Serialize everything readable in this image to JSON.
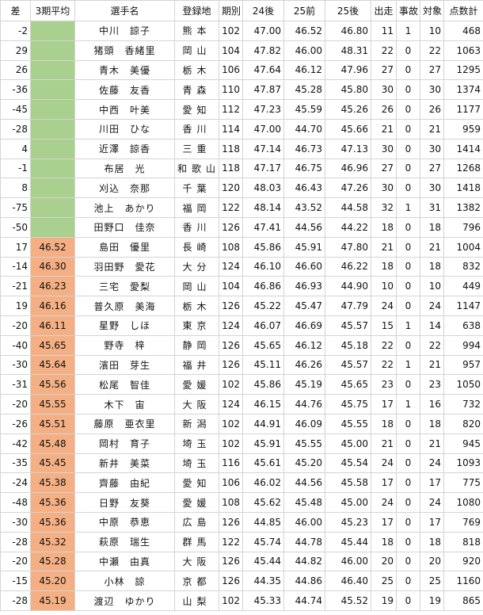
{
  "colors": {
    "green": "#a9d08e",
    "orange": "#f4b084",
    "grid": "#d4d4d4"
  },
  "headers": [
    "差",
    "3期平均",
    "選手名",
    "登録地",
    "期別",
    "24後",
    "25前",
    "25後",
    "出走",
    "事故",
    "対象",
    "点数計"
  ],
  "rows": [
    {
      "diff": "-2",
      "avg": "",
      "name": "中川　諒子",
      "region": "熊本",
      "ki": "102",
      "s24b": "47.00",
      "s25f": "46.52",
      "s25b": "46.80",
      "starts": "11",
      "acc": "1",
      "tgt": "10",
      "pts": "468",
      "band": "green"
    },
    {
      "diff": "29",
      "avg": "",
      "name": "猪頭　香緒里",
      "region": "岡山",
      "ki": "104",
      "s24b": "47.82",
      "s25f": "46.00",
      "s25b": "48.31",
      "starts": "22",
      "acc": "0",
      "tgt": "22",
      "pts": "1063",
      "band": "green"
    },
    {
      "diff": "26",
      "avg": "",
      "name": "青木　美優",
      "region": "栃木",
      "ki": "106",
      "s24b": "47.64",
      "s25f": "46.12",
      "s25b": "47.96",
      "starts": "27",
      "acc": "0",
      "tgt": "27",
      "pts": "1295",
      "band": "green"
    },
    {
      "diff": "-36",
      "avg": "",
      "name": "佐藤　友香",
      "region": "青森",
      "ki": "110",
      "s24b": "47.87",
      "s25f": "45.28",
      "s25b": "45.80",
      "starts": "30",
      "acc": "0",
      "tgt": "30",
      "pts": "1374",
      "band": "green"
    },
    {
      "diff": "-45",
      "avg": "",
      "name": "中西　叶美",
      "region": "愛知",
      "ki": "112",
      "s24b": "47.23",
      "s25f": "45.59",
      "s25b": "45.26",
      "starts": "26",
      "acc": "0",
      "tgt": "26",
      "pts": "1177",
      "band": "green"
    },
    {
      "diff": "-28",
      "avg": "",
      "name": "川田　ひな",
      "region": "香川",
      "ki": "114",
      "s24b": "47.00",
      "s25f": "44.70",
      "s25b": "45.66",
      "starts": "21",
      "acc": "0",
      "tgt": "21",
      "pts": "959",
      "band": "green"
    },
    {
      "diff": "4",
      "avg": "",
      "name": "近澤　諒香",
      "region": "三重",
      "ki": "118",
      "s24b": "47.14",
      "s25f": "46.73",
      "s25b": "47.13",
      "starts": "30",
      "acc": "0",
      "tgt": "30",
      "pts": "1414",
      "band": "green"
    },
    {
      "diff": "-1",
      "avg": "",
      "name": "布居　光",
      "region": "和歌山",
      "ki": "118",
      "s24b": "47.17",
      "s25f": "46.75",
      "s25b": "46.96",
      "starts": "27",
      "acc": "0",
      "tgt": "27",
      "pts": "1268",
      "band": "green"
    },
    {
      "diff": "8",
      "avg": "",
      "name": "刈込　奈那",
      "region": "千葉",
      "ki": "120",
      "s24b": "48.03",
      "s25f": "46.43",
      "s25b": "47.26",
      "starts": "30",
      "acc": "0",
      "tgt": "30",
      "pts": "1418",
      "band": "green"
    },
    {
      "diff": "-75",
      "avg": "",
      "name": "池上　あかり",
      "region": "福岡",
      "ki": "122",
      "s24b": "48.14",
      "s25f": "43.52",
      "s25b": "44.58",
      "starts": "32",
      "acc": "1",
      "tgt": "31",
      "pts": "1382",
      "band": "green"
    },
    {
      "diff": "-50",
      "avg": "",
      "name": "田野口　佳奈",
      "region": "香川",
      "ki": "126",
      "s24b": "47.41",
      "s25f": "44.56",
      "s25b": "44.22",
      "starts": "18",
      "acc": "0",
      "tgt": "18",
      "pts": "796",
      "band": "green"
    },
    {
      "diff": "17",
      "avg": "46.52",
      "name": "島田　優里",
      "region": "長崎",
      "ki": "108",
      "s24b": "45.86",
      "s25f": "45.91",
      "s25b": "47.80",
      "starts": "21",
      "acc": "0",
      "tgt": "21",
      "pts": "1004",
      "band": "orange"
    },
    {
      "diff": "-14",
      "avg": "46.30",
      "name": "羽田野　愛花",
      "region": "大分",
      "ki": "124",
      "s24b": "46.10",
      "s25f": "46.60",
      "s25b": "46.22",
      "starts": "18",
      "acc": "0",
      "tgt": "18",
      "pts": "832",
      "band": "orange"
    },
    {
      "diff": "-21",
      "avg": "46.23",
      "name": "三宅　愛梨",
      "region": "岡山",
      "ki": "104",
      "s24b": "46.86",
      "s25f": "46.93",
      "s25b": "44.90",
      "starts": "10",
      "acc": "0",
      "tgt": "10",
      "pts": "449",
      "band": "orange"
    },
    {
      "diff": "19",
      "avg": "46.16",
      "name": "普久原　美海",
      "region": "栃木",
      "ki": "126",
      "s24b": "45.22",
      "s25f": "45.47",
      "s25b": "47.79",
      "starts": "24",
      "acc": "0",
      "tgt": "24",
      "pts": "1147",
      "band": "orange"
    },
    {
      "diff": "-20",
      "avg": "46.11",
      "name": "星野　しほ",
      "region": "東京",
      "ki": "124",
      "s24b": "46.07",
      "s25f": "46.69",
      "s25b": "45.57",
      "starts": "15",
      "acc": "1",
      "tgt": "14",
      "pts": "638",
      "band": "orange"
    },
    {
      "diff": "-40",
      "avg": "45.65",
      "name": "野寺　梓",
      "region": "静岡",
      "ki": "126",
      "s24b": "45.65",
      "s25f": "46.12",
      "s25b": "45.18",
      "starts": "22",
      "acc": "0",
      "tgt": "22",
      "pts": "994",
      "band": "orange"
    },
    {
      "diff": "-30",
      "avg": "45.64",
      "name": "濱田　芽生",
      "region": "福井",
      "ki": "126",
      "s24b": "45.11",
      "s25f": "46.26",
      "s25b": "45.57",
      "starts": "22",
      "acc": "1",
      "tgt": "21",
      "pts": "957",
      "band": "orange"
    },
    {
      "diff": "-31",
      "avg": "45.56",
      "name": "松尾　智佳",
      "region": "愛媛",
      "ki": "102",
      "s24b": "45.86",
      "s25f": "45.19",
      "s25b": "45.65",
      "starts": "23",
      "acc": "0",
      "tgt": "23",
      "pts": "1050",
      "band": "orange"
    },
    {
      "diff": "-20",
      "avg": "45.55",
      "name": "木下　宙",
      "region": "大阪",
      "ki": "124",
      "s24b": "46.15",
      "s25f": "44.76",
      "s25b": "45.75",
      "starts": "17",
      "acc": "1",
      "tgt": "16",
      "pts": "732",
      "band": "orange"
    },
    {
      "diff": "-26",
      "avg": "45.51",
      "name": "藤原　亜衣里",
      "region": "新潟",
      "ki": "102",
      "s24b": "44.91",
      "s25f": "46.09",
      "s25b": "45.55",
      "starts": "18",
      "acc": "0",
      "tgt": "18",
      "pts": "820",
      "band": "orange"
    },
    {
      "diff": "-42",
      "avg": "45.48",
      "name": "岡村　育子",
      "region": "埼玉",
      "ki": "102",
      "s24b": "45.91",
      "s25f": "45.55",
      "s25b": "45.00",
      "starts": "21",
      "acc": "0",
      "tgt": "21",
      "pts": "945",
      "band": "orange"
    },
    {
      "diff": "-35",
      "avg": "45.45",
      "name": "新井　美菜",
      "region": "埼玉",
      "ki": "116",
      "s24b": "45.61",
      "s25f": "45.20",
      "s25b": "45.54",
      "starts": "24",
      "acc": "0",
      "tgt": "24",
      "pts": "1093",
      "band": "orange"
    },
    {
      "diff": "-24",
      "avg": "45.38",
      "name": "齊藤　由紀",
      "region": "愛知",
      "ki": "106",
      "s24b": "46.02",
      "s25f": "44.56",
      "s25b": "45.58",
      "starts": "17",
      "acc": "0",
      "tgt": "17",
      "pts": "775",
      "band": "orange"
    },
    {
      "diff": "-48",
      "avg": "45.36",
      "name": "日野　友葵",
      "region": "愛媛",
      "ki": "108",
      "s24b": "45.62",
      "s25f": "45.48",
      "s25b": "45.00",
      "starts": "24",
      "acc": "0",
      "tgt": "24",
      "pts": "1080",
      "band": "orange"
    },
    {
      "diff": "-30",
      "avg": "45.36",
      "name": "中原　恭恵",
      "region": "広島",
      "ki": "126",
      "s24b": "44.85",
      "s25f": "46.00",
      "s25b": "45.23",
      "starts": "17",
      "acc": "0",
      "tgt": "17",
      "pts": "769",
      "band": "orange"
    },
    {
      "diff": "-28",
      "avg": "45.32",
      "name": "萩原　瑞生",
      "region": "群馬",
      "ki": "122",
      "s24b": "45.74",
      "s25f": "44.78",
      "s25b": "45.44",
      "starts": "18",
      "acc": "0",
      "tgt": "18",
      "pts": "818",
      "band": "orange"
    },
    {
      "diff": "-20",
      "avg": "45.28",
      "name": "中瀬　由真",
      "region": "大阪",
      "ki": "126",
      "s24b": "45.44",
      "s25f": "44.82",
      "s25b": "46.00",
      "starts": "20",
      "acc": "0",
      "tgt": "20",
      "pts": "920",
      "band": "orange"
    },
    {
      "diff": "-15",
      "avg": "45.20",
      "name": "小林　諒",
      "region": "京都",
      "ki": "126",
      "s24b": "44.35",
      "s25f": "44.86",
      "s25b": "46.40",
      "starts": "25",
      "acc": "0",
      "tgt": "25",
      "pts": "1160",
      "band": "orange"
    },
    {
      "diff": "-28",
      "avg": "45.19",
      "name": "渡辺　ゆかり",
      "region": "山梨",
      "ki": "102",
      "s24b": "45.33",
      "s25f": "44.74",
      "s25b": "45.52",
      "starts": "19",
      "acc": "0",
      "tgt": "19",
      "pts": "865",
      "band": "orange"
    }
  ]
}
